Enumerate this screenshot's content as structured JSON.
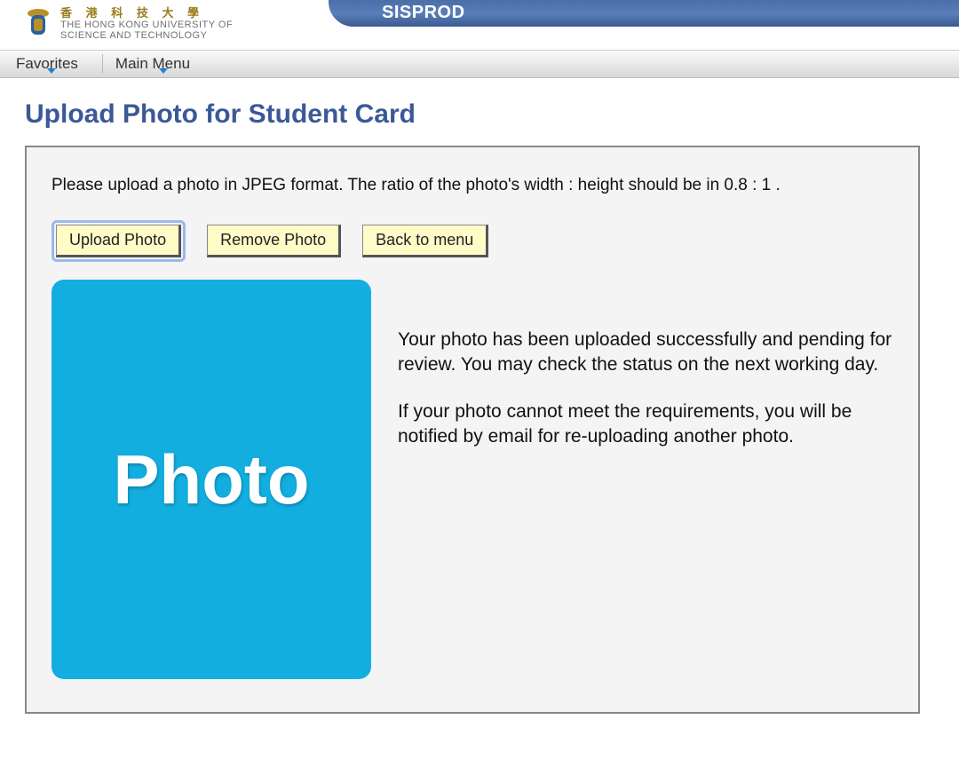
{
  "header": {
    "system_title": "SISPROD",
    "logo": {
      "cn": "香 港 科 技 大 學",
      "en_line1": "THE HONG KONG UNIVERSITY OF",
      "en_line2": "SCIENCE AND TECHNOLOGY"
    }
  },
  "menubar": {
    "items": [
      "Favorites",
      "Main Menu"
    ]
  },
  "page": {
    "title": "Upload Photo for Student Card",
    "instructions": "Please upload a photo in JPEG format. The ratio of the photo's width : height should be in 0.8 : 1 .",
    "buttons": {
      "upload": "Upload Photo",
      "remove": "Remove Photo",
      "back": "Back to menu"
    },
    "photo_placeholder_label": "Photo",
    "status_paragraph_1": "Your photo has been uploaded successfully and pending for review. You may check the status on the next working day.",
    "status_paragraph_2": "If your photo cannot meet the requirements, you will be notified by email for re-uploading another photo."
  }
}
